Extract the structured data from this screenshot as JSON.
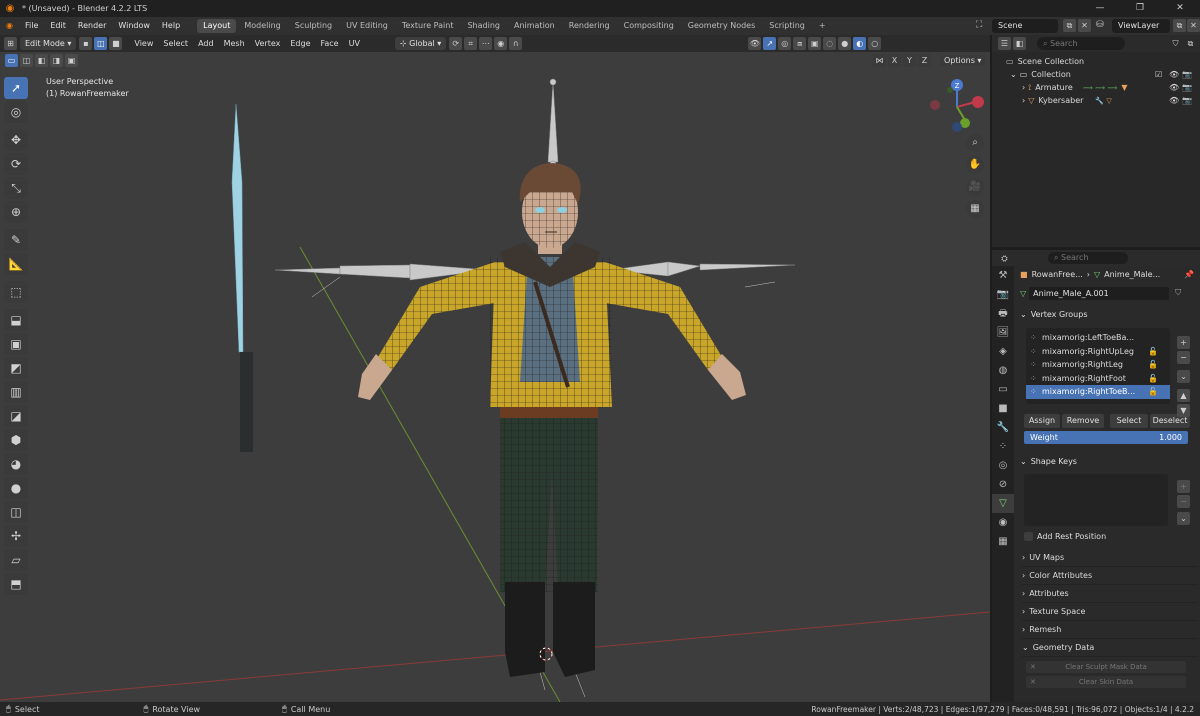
{
  "window": {
    "title": "* (Unsaved) - Blender 4.2.2 LTS"
  },
  "menus": [
    "File",
    "Edit",
    "Render",
    "Window",
    "Help"
  ],
  "workspaces": [
    "Layout",
    "Modeling",
    "Sculpting",
    "UV Editing",
    "Texture Paint",
    "Shading",
    "Animation",
    "Rendering",
    "Compositing",
    "Geometry Nodes",
    "Scripting"
  ],
  "active_workspace": "Layout",
  "scene": {
    "name": "Scene",
    "view_layer": "ViewLayer"
  },
  "viewport_header": {
    "mode": "Edit Mode",
    "menus": [
      "View",
      "Select",
      "Add",
      "Mesh",
      "Vertex",
      "Edge",
      "Face",
      "UV"
    ],
    "transform_orientation": "Global",
    "axes": [
      "X",
      "Y",
      "Z"
    ],
    "options_label": "Options"
  },
  "viewport": {
    "view_label": "User Perspective",
    "object_label": "(1) RowanFreemaker"
  },
  "outliner": {
    "search_placeholder": "Search",
    "items": [
      {
        "label": "Scene Collection"
      },
      {
        "label": "Collection"
      },
      {
        "label": "Armature"
      },
      {
        "label": "Kybersaber"
      }
    ]
  },
  "properties": {
    "search_placeholder": "Search",
    "breadcrumb": [
      "RowanFree...",
      "Anime_Male..."
    ],
    "mesh_name": "Anime_Male_A.001",
    "vertex_groups_title": "Vertex Groups",
    "vertex_groups": [
      "mixamorig:LeftToeBa...",
      "mixamorig:RightUpLeg",
      "mixamorig:RightLeg",
      "mixamorig:RightFoot",
      "mixamorig:RightToeB..."
    ],
    "selected_vertex_group_index": 4,
    "buttons": {
      "assign": "Assign",
      "remove": "Remove",
      "select": "Select",
      "deselect": "Deselect"
    },
    "weight": {
      "label": "Weight",
      "value": "1.000"
    },
    "shape_keys_title": "Shape Keys",
    "add_rest_position": "Add Rest Position",
    "sections": [
      "UV Maps",
      "Color Attributes",
      "Attributes",
      "Texture Space",
      "Remesh",
      "Geometry Data"
    ],
    "clear_sculpt_mask": "Clear Sculpt Mask Data",
    "clear_skin_data": "Clear Skin Data"
  },
  "status_bar": {
    "hint_select": "Select",
    "hint_rotate": "Rotate View",
    "hint_menu": "Call Menu",
    "stats": "RowanFreemaker | Verts:2/48,723 | Edges:1/97,279 | Faces:0/48,591 | Tris:96,072 | Objects:1/4 | 4.2.2"
  },
  "colors": {
    "accent": "#4772b3",
    "viewport_bg": "#3d3d3d",
    "jacket": "#c9a62a",
    "pants": "#2b3a30",
    "sword_blade": "#9fd3e4"
  }
}
